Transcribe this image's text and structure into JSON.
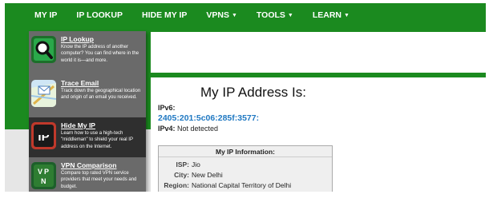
{
  "nav": {
    "items": [
      {
        "label": "MY IP",
        "caret": ""
      },
      {
        "label": "IP LOOKUP",
        "caret": ""
      },
      {
        "label": "HIDE MY IP",
        "caret": ""
      },
      {
        "label": "VPNS",
        "caret": "▼"
      },
      {
        "label": "TOOLS",
        "caret": "▼"
      },
      {
        "label": "LEARN",
        "caret": "▼"
      }
    ]
  },
  "dropdown": {
    "items": [
      {
        "title": "IP Lookup",
        "description": "Know the IP address of another computer? You can find where in the world it is—and more.",
        "icon": "ip-lookup-icon"
      },
      {
        "title": "Trace Email",
        "description": "Track down the geographical location and origin of an email you received.",
        "icon": "trace-email-icon"
      },
      {
        "title": "Hide My IP",
        "description": "Learn how to use a high-tech \"middleman\" to shield your real IP address on the Internet.",
        "icon": "hide-my-ip-icon"
      },
      {
        "title": "VPN Comparison",
        "description": "Compare top rated VPN service providers that meet your needs and budget.",
        "icon": "vpn-comparison-icon"
      }
    ]
  },
  "main": {
    "heading": "My IP Address Is:",
    "ipv6_label": "IPv6:",
    "ipv6_value": "2405:201:5c06:285f:3577:",
    "ipv4_label": "IPv4:",
    "ipv4_value": "Not detected"
  },
  "info": {
    "title": "My IP Information:",
    "rows": [
      {
        "key": "ISP:",
        "value": "Jio"
      },
      {
        "key": "City:",
        "value": "New Delhi"
      },
      {
        "key": "Region:",
        "value": "National Capital Territory of Delhi"
      }
    ]
  },
  "colors": {
    "brand_green": "#1b8a1f",
    "dropdown_bg": "#6a6a6a",
    "dropdown_active": "#2f2f2f",
    "ip_link_blue": "#1f78c2"
  }
}
